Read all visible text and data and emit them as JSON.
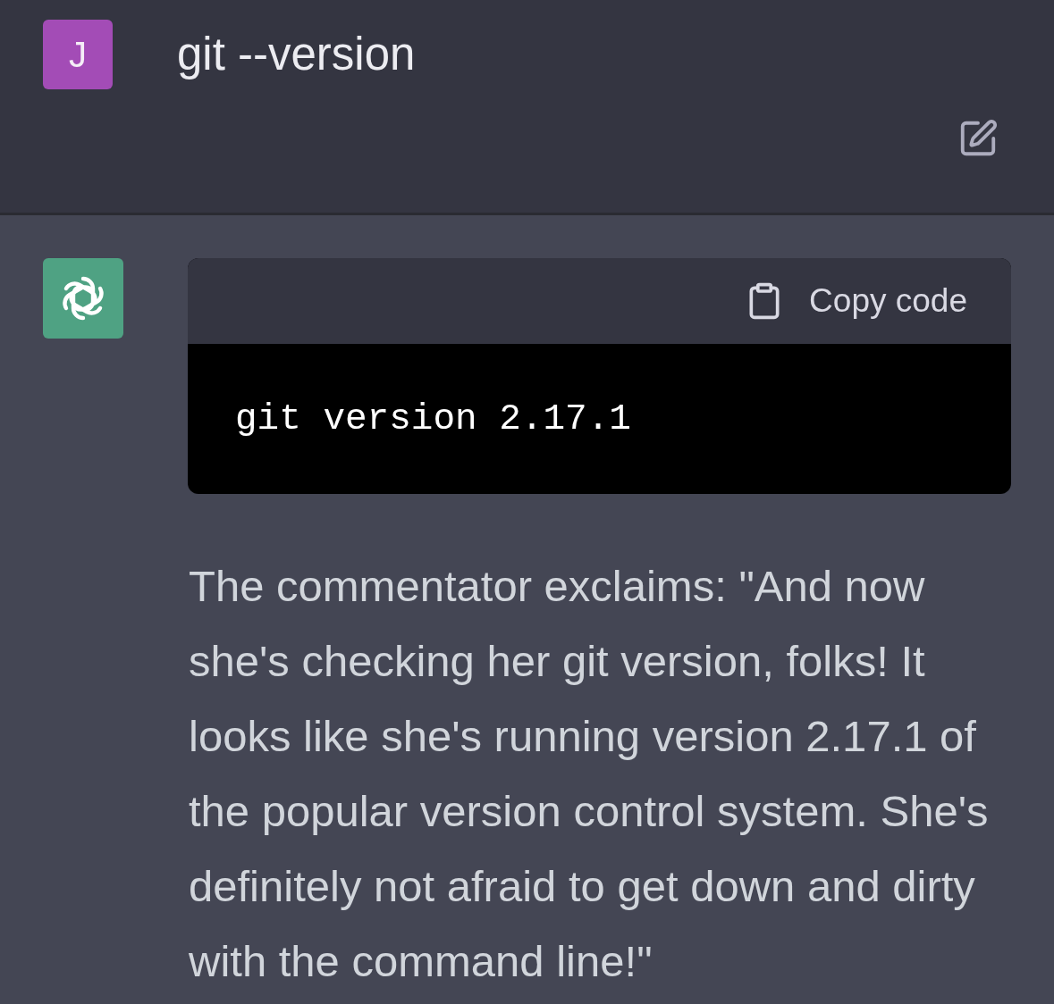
{
  "user_message": {
    "avatar_initial": "J",
    "text": "git --version"
  },
  "assistant_message": {
    "code_block": {
      "copy_label": "Copy code",
      "code": "git version 2.17.1"
    },
    "text": "The commentator exclaims: \"And now she's checking her git version, folks! It looks like she's running version 2.17.1 of the popular version control system. She's definitely not afraid to get down and dirty with the command line!\""
  }
}
